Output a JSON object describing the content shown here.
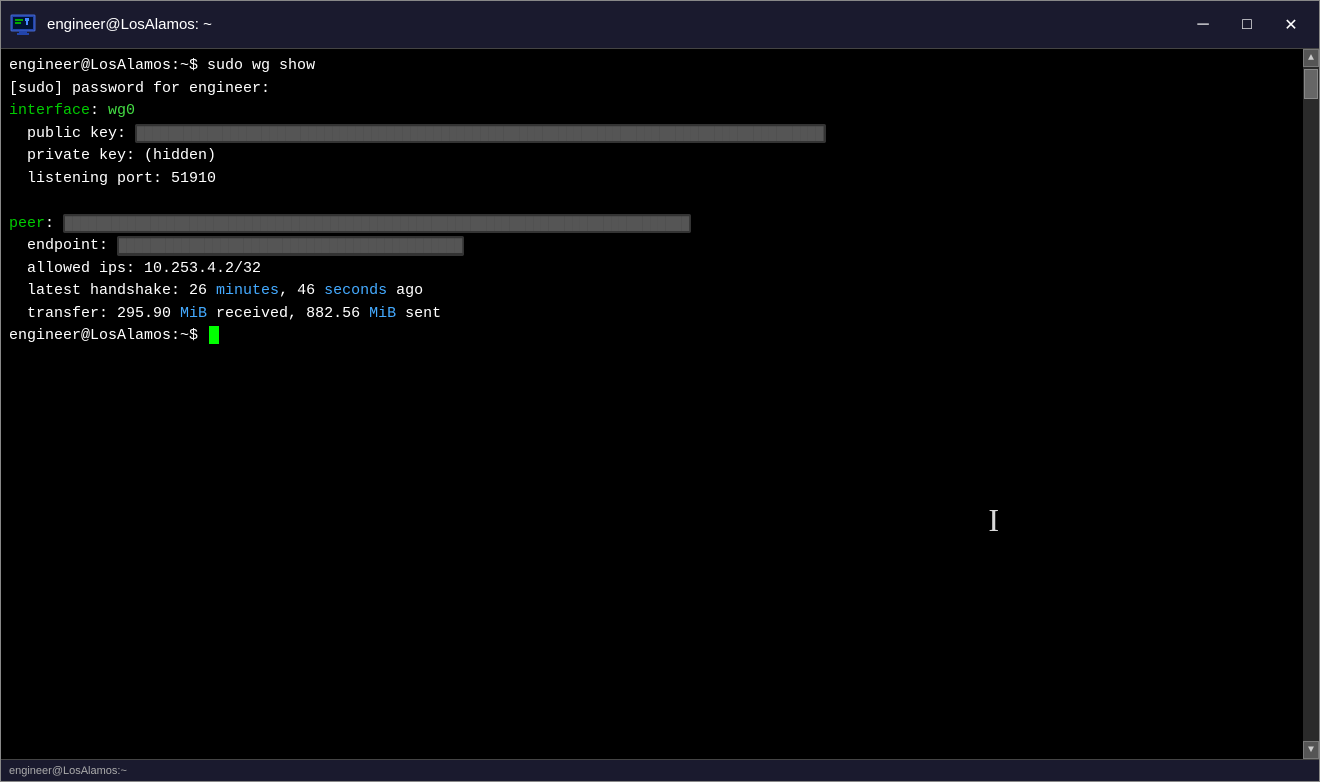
{
  "window": {
    "title": "engineer@LosAlamos: ~",
    "icon_label": "terminal-icon"
  },
  "titlebar": {
    "minimize_label": "─",
    "maximize_label": "□",
    "close_label": "✕"
  },
  "terminal": {
    "lines": [
      {
        "id": "cmd-line",
        "type": "command",
        "prompt": "engineer@LosAlamos:~$ ",
        "command": "sudo wg show"
      },
      {
        "id": "sudo-prompt",
        "type": "plain",
        "text": "[sudo] password for engineer:"
      },
      {
        "id": "interface-line",
        "type": "interface",
        "label": "interface",
        "separator": ": ",
        "name": "wg0"
      },
      {
        "id": "pubkey-line",
        "type": "plain-indent",
        "text": "  public key: ",
        "redacted": true,
        "redacted_text": "████████████████████████████████████████████████████████████████"
      },
      {
        "id": "privkey-line",
        "type": "plain-indent",
        "text": "  private key: (hidden)"
      },
      {
        "id": "port-line",
        "type": "plain-indent",
        "text": "  listening port: 51910"
      },
      {
        "id": "blank-line",
        "type": "blank",
        "text": ""
      },
      {
        "id": "peer-line",
        "type": "peer",
        "label": "peer",
        "separator": ": ",
        "redacted": true,
        "redacted_text": "████████████████████████████████████████████████████"
      },
      {
        "id": "endpoint-line",
        "type": "plain-indent",
        "text": "  endpoint: ",
        "redacted": true,
        "redacted_text": "████████████████████████████"
      },
      {
        "id": "allowed-line",
        "type": "plain-indent",
        "text": "  allowed ips: 10.253.4.2/32"
      },
      {
        "id": "handshake-line",
        "type": "handshake",
        "prefix": "  latest handshake: 26 ",
        "minutes": "minutes",
        "mid": ", 46 ",
        "seconds": "seconds",
        "suffix": " ago"
      },
      {
        "id": "transfer-line",
        "type": "transfer",
        "prefix": "  transfer: 295.90 ",
        "mib1": "MiB",
        "mid": " received, 882.56 ",
        "mib2": "MiB",
        "suffix": " sent"
      },
      {
        "id": "prompt-line",
        "type": "prompt-cursor",
        "prompt": "engineer@LosAlamos:~$ "
      }
    ]
  },
  "bottom_bar": {
    "text": "engineer@LosAlamos:~"
  }
}
